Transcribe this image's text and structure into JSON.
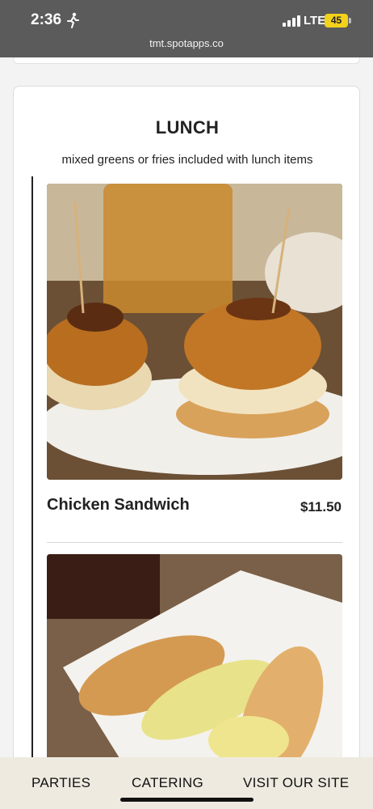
{
  "status_bar": {
    "time": "2:36",
    "network": "LTE",
    "battery": "45",
    "url": "tmt.spotapps.co"
  },
  "menu": {
    "section_title": "LUNCH",
    "section_description": "mixed greens or fries included with lunch items",
    "items": [
      {
        "name": "Chicken Sandwich",
        "price": "$11.50"
      }
    ]
  },
  "bottom_nav": {
    "parties": "PARTIES",
    "catering": "CATERING",
    "visit": "VISIT OUR SITE"
  },
  "colors": {
    "status_bar_bg": "#5b5b5b",
    "battery": "#f2d21b",
    "bottom_nav_bg": "#eeeae0",
    "text": "#222222"
  }
}
